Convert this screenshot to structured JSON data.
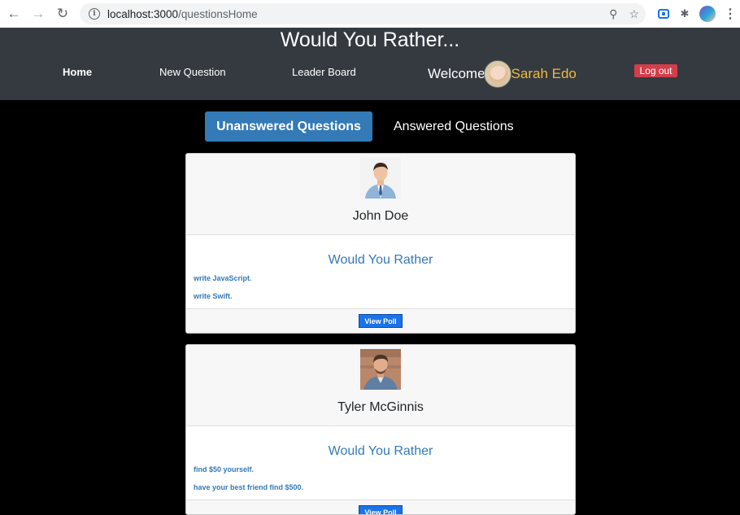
{
  "browser": {
    "url_host": "localhost:3000",
    "url_path": "/questionsHome"
  },
  "app": {
    "title": "Would You Rather..."
  },
  "nav": {
    "home": "Home",
    "new_question": "New Question",
    "leader_board": "Leader Board",
    "welcome": "Welcome",
    "user_name": "Sarah Edo",
    "logout": "Log out"
  },
  "tabs": {
    "unanswered": "Unanswered Questions",
    "answered": "Answered Questions"
  },
  "questions": [
    {
      "author": "John Doe",
      "heading": "Would You Rather",
      "option_one": "write JavaScript.",
      "option_two": "write Swift.",
      "button": "View Poll"
    },
    {
      "author": "Tyler McGinnis",
      "heading": "Would You Rather",
      "option_one": "find $50 yourself.",
      "option_two": "have your best friend find $500.",
      "button": "View Poll"
    }
  ],
  "colors": {
    "navbar": "#343a40",
    "accent": "#337ab7",
    "user_name": "#f0b93b",
    "logout": "#d23e4a",
    "button": "#1a73e8"
  }
}
